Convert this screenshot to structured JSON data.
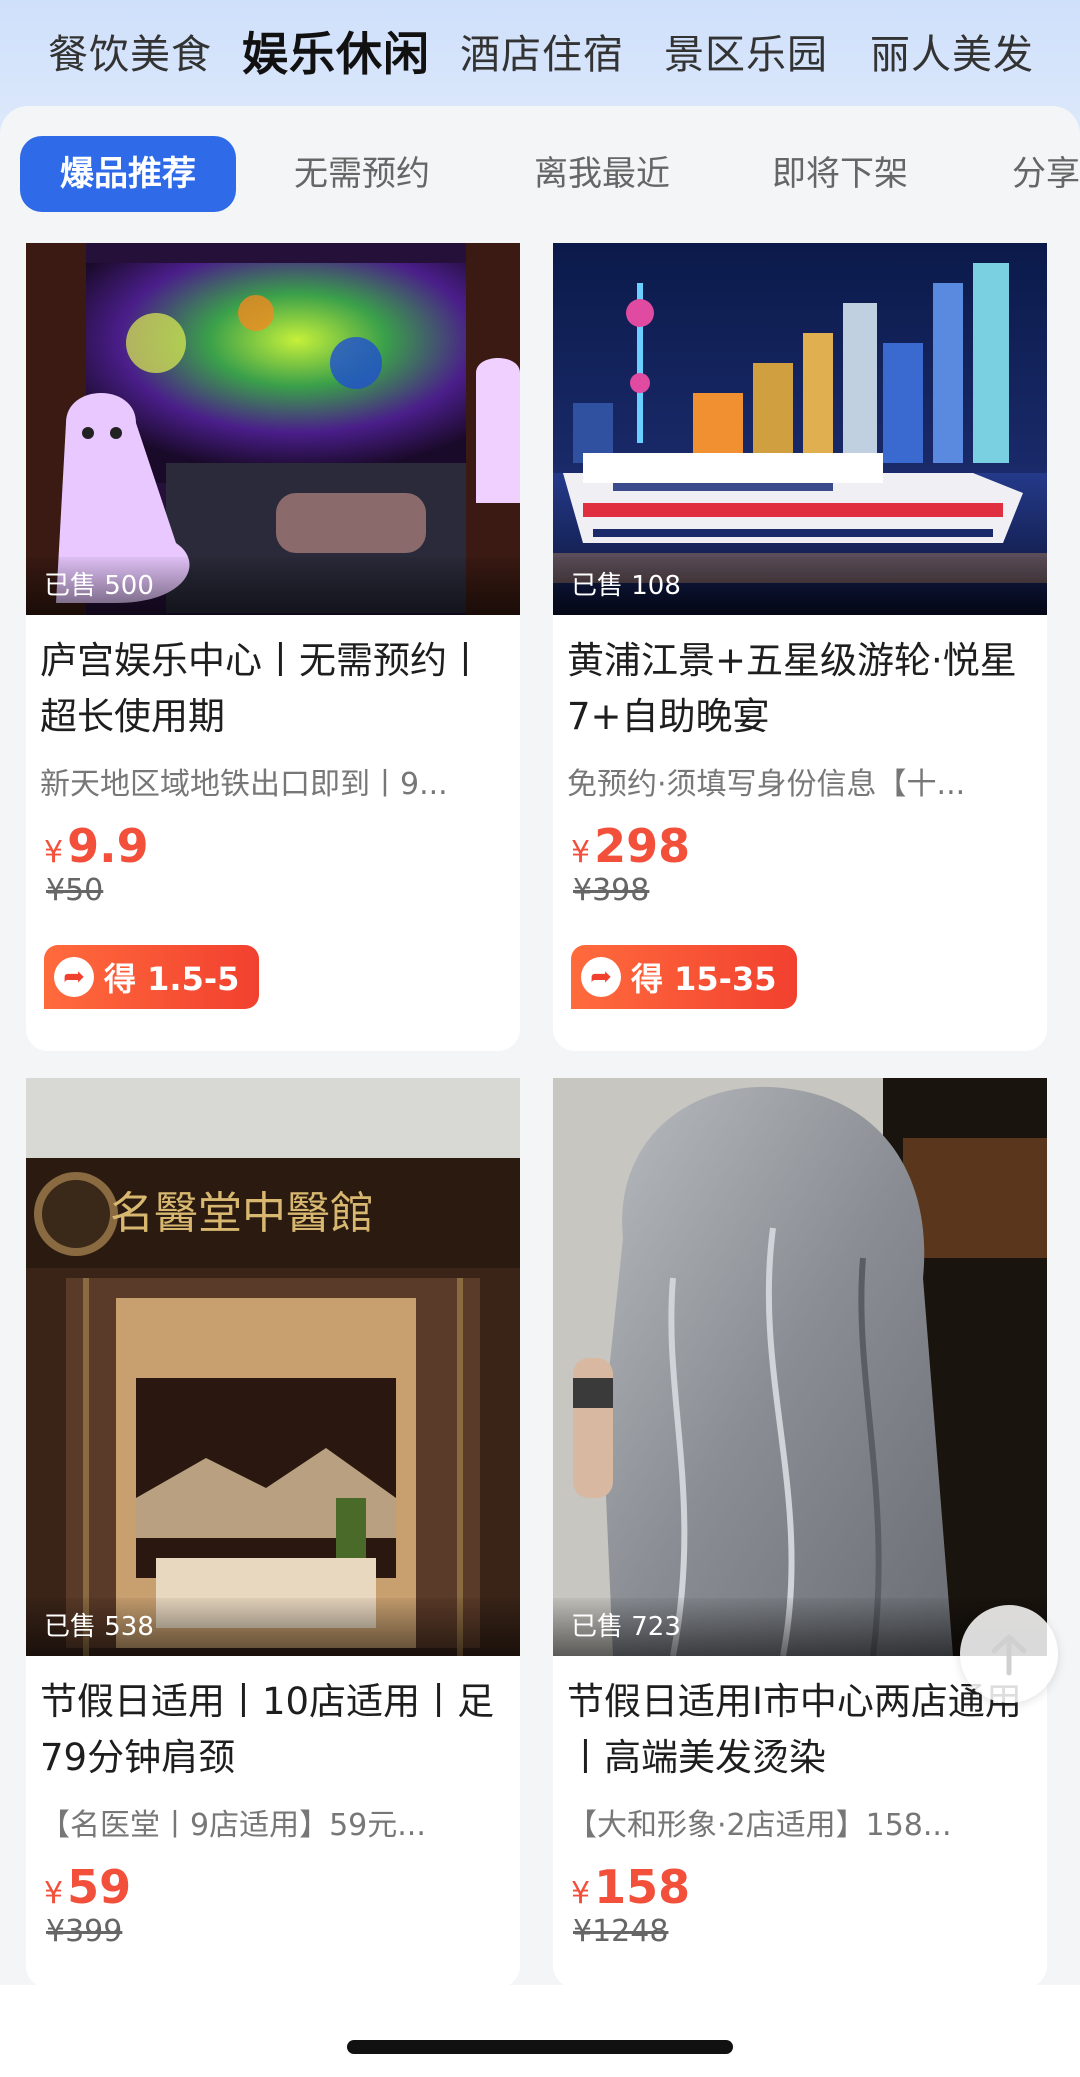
{
  "categories": [
    {
      "label": "餐饮美食",
      "active": false
    },
    {
      "label": "娱乐休闲",
      "active": true
    },
    {
      "label": "酒店住宿",
      "active": false
    },
    {
      "label": "景区乐园",
      "active": false
    },
    {
      "label": "丽人美发",
      "active": false
    }
  ],
  "filters": [
    "爆品推荐",
    "无需预约",
    "离我最近",
    "即将下架",
    "分享"
  ],
  "products": [
    {
      "sold": "已售 500",
      "title": "庐宫娱乐中心丨无需预约丨超长使用期",
      "subtitle": "新天地区域地铁出口即到丨9...",
      "currency": "¥",
      "price": "9.9",
      "original_price": "¥50",
      "reward": "得 1.5-5"
    },
    {
      "sold": "已售 108",
      "title": "黄浦江景+五星级游轮·悦星7+自助晚宴",
      "subtitle": "免预约·须填写身份信息【十...",
      "currency": "¥",
      "price": "298",
      "original_price": "¥398",
      "reward": "得 15-35"
    },
    {
      "sold": "已售 538",
      "title": "节假日适用丨10店适用丨足79分钟肩颈",
      "subtitle": "【名医堂丨9店适用】59元...",
      "currency": "¥",
      "price": "59",
      "original_price": "¥399",
      "sign_text": "名醫堂中醫館"
    },
    {
      "sold": "已售 723",
      "title": "节假日适用I市中心两店通用丨高端美发烫染",
      "subtitle": "【大和形象·2店适用】158...",
      "currency": "¥",
      "price": "158",
      "original_price": "¥1248"
    }
  ],
  "colors": {
    "accent": "#2f6be8",
    "price": "#f2503b"
  },
  "icons": {
    "share": "share-arrow-icon",
    "back_to_top": "arrow-up-icon"
  }
}
